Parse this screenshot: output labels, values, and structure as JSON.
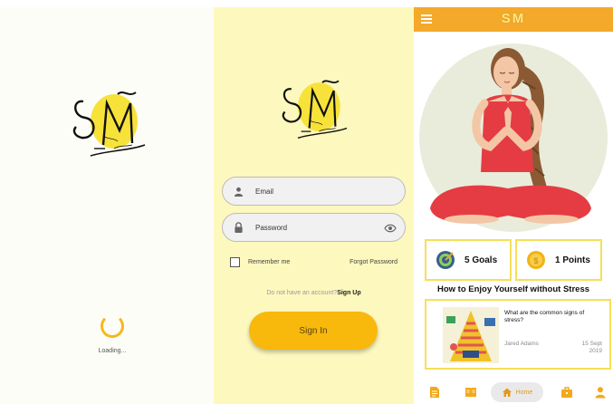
{
  "splash": {
    "loading_text": "Loading..."
  },
  "login": {
    "email_placeholder": "Email",
    "password_placeholder": "Password",
    "remember_label": "Remember me",
    "forgot_label": "Forgot Password",
    "signup_prompt": "Do not have an account?",
    "signup_link": "Sign Up",
    "signin_label": "Sign In"
  },
  "home": {
    "header_title": "SM",
    "goals_label": "5 Goals",
    "points_label": "1 Points",
    "section_title": "How to Enjoy Yourself without Stress",
    "article": {
      "title": "What are the common signs of stress?",
      "author": "Jared Adams",
      "date": "15 Sept 2019"
    },
    "nav": {
      "home_label": "Home"
    }
  },
  "icons": {
    "menu": "hamburger-menu-icon",
    "user": "user-icon",
    "lock": "lock-icon",
    "eye": "eye-icon",
    "target": "target-icon",
    "coin": "coin-icon",
    "document": "document-icon",
    "book": "book-icon",
    "home": "home-icon",
    "briefcase": "briefcase-icon",
    "profile": "profile-icon"
  },
  "colors": {
    "accent": "#f8b80c",
    "topbar": "#f4a92a",
    "card_border": "#f7df56",
    "login_bg": "#fdf8be"
  }
}
